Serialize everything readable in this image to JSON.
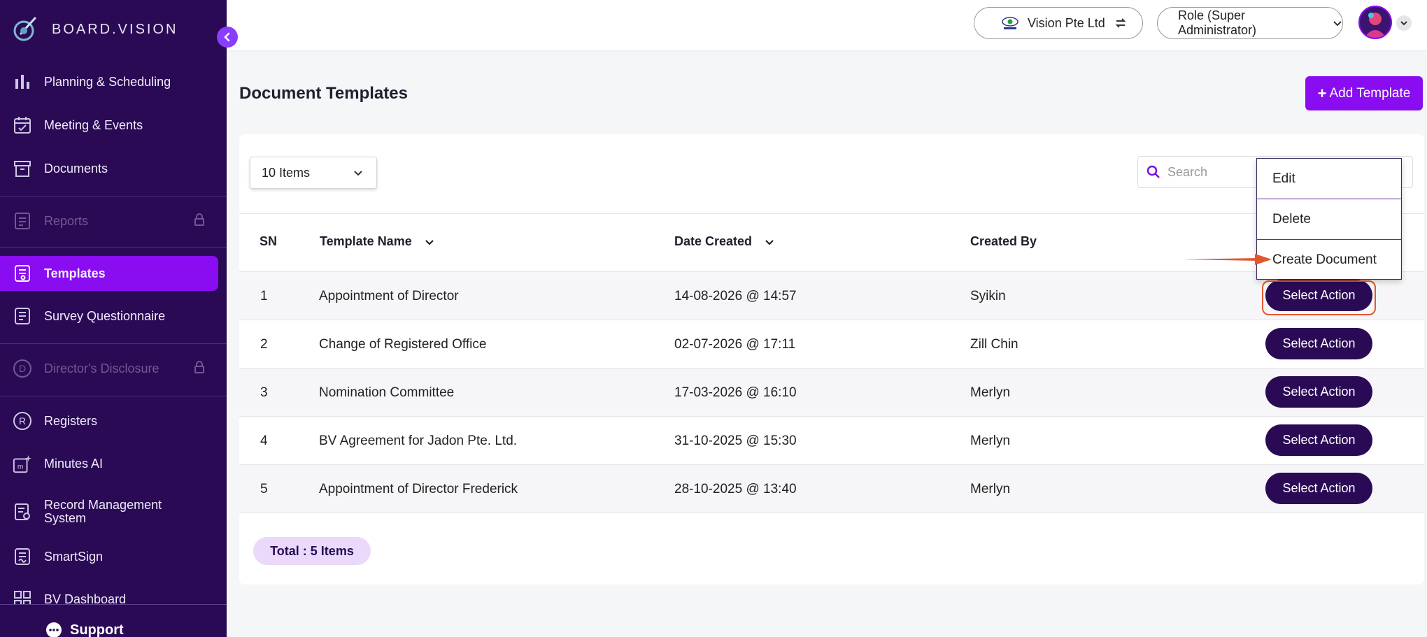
{
  "app": {
    "brand": "BOARD.VISION"
  },
  "sidebar": {
    "items": [
      {
        "label": "Planning & Scheduling",
        "icon": "bar-chart-icon"
      },
      {
        "label": "Meeting & Events",
        "icon": "calendar-check-icon"
      },
      {
        "label": "Documents",
        "icon": "archive-box-icon"
      },
      {
        "label": "Reports",
        "icon": "list-doc-icon",
        "locked": true
      },
      {
        "label": "Templates",
        "icon": "template-icon",
        "active": true
      },
      {
        "label": "Survey Questionnaire",
        "icon": "survey-icon"
      },
      {
        "label": "Director's Disclosure",
        "icon": "d-circle-icon",
        "locked": true
      },
      {
        "label": "Registers",
        "icon": "r-circle-icon"
      },
      {
        "label": "Minutes AI",
        "icon": "minutes-ai-icon"
      },
      {
        "label_line1": "Record Management",
        "label_line2": "System",
        "icon": "record-mgmt-icon"
      },
      {
        "label": "SmartSign",
        "icon": "smartsign-icon"
      },
      {
        "label": "BV Dashboard",
        "icon": "dashboard-grid-icon"
      }
    ],
    "support_label": "Support"
  },
  "topbar": {
    "org_name": "Vision Pte Ltd",
    "role_label": "Role (Super Administrator)"
  },
  "page": {
    "title": "Document Templates",
    "add_button_label": "Add Template",
    "items_per_page": "10 Items",
    "search_placeholder": "Search"
  },
  "table": {
    "headers": {
      "sn": "SN",
      "template_name": "Template Name",
      "date_created": "Date Created",
      "created_by": "Created By"
    },
    "action_label": "Select Action",
    "rows": [
      {
        "sn": "1",
        "name": "Appointment of Director",
        "date": "14-08-2026 @ 14:57",
        "by": "Syikin"
      },
      {
        "sn": "2",
        "name": "Change of Registered Office",
        "date": "02-07-2026 @ 17:11",
        "by": "Zill Chin"
      },
      {
        "sn": "3",
        "name": "Nomination Committee",
        "date": "17-03-2026 @ 16:10",
        "by": "Merlyn"
      },
      {
        "sn": "4",
        "name": "BV Agreement for Jadon Pte. Ltd.",
        "date": "31-10-2025 @ 15:30",
        "by": "Merlyn"
      },
      {
        "sn": "5",
        "name": "Appointment of Director Frederick",
        "date": "28-10-2025 @ 13:40",
        "by": "Merlyn"
      }
    ]
  },
  "dropdown": {
    "items": [
      "Edit",
      "Delete",
      "Create Document"
    ]
  },
  "footer": {
    "total_label": "Total : 5 Items"
  },
  "colors": {
    "sidebar_bg": "#2a0a55",
    "accent": "#8a0cf0",
    "action_btn": "#2a0a55",
    "highlight": "#e4572e"
  }
}
